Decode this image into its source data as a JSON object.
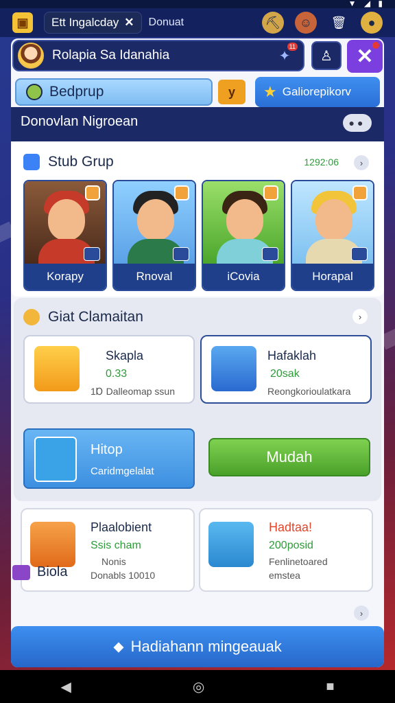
{
  "header": {
    "tab_title": "Ett Ingalcday",
    "tab_sub": "Donuat"
  },
  "profile": {
    "name": "Rolapia Sa Idanahia",
    "notif_badge": "11"
  },
  "group_button": {
    "label": "Bedprup"
  },
  "y_button": {
    "label": "y"
  },
  "category_button": {
    "label": "Galiorepikorv"
  },
  "subtitle": "Donovlan Nigroean",
  "stub": {
    "title": "Stub Grup",
    "date": "1292:06",
    "people": [
      "Korapy",
      "Rnoval",
      "iCovia",
      "Horapal"
    ]
  },
  "gifts": {
    "title": "Giat Clamaitan",
    "items": [
      {
        "name": "Skapla",
        "value": "0.33",
        "desc": "1Ɒ Dalleomap ssun"
      },
      {
        "name": "Hafaklah",
        "value": "20sak",
        "desc": "Reongkorioulatkara"
      }
    ],
    "hitop": {
      "title": "Hitop",
      "sub": "Caridmgelalat"
    },
    "mudah": "Mudah"
  },
  "bottom_cards": [
    {
      "name": "Plaalobient",
      "line1": "Ssis cham",
      "line2": "Nonis",
      "line3": "Donabls 10010"
    },
    {
      "name": "Hadtaa!",
      "line1": "200posid",
      "line2": "Fenlinetoared",
      "line3": "emstea"
    }
  ],
  "section3": {
    "title": "Biola"
  },
  "cta": {
    "label": "Hadiahann mingeauak"
  },
  "colors": {
    "accent": "#2667c9",
    "green": "#4aa12a",
    "purple": "#7b3fe0"
  }
}
